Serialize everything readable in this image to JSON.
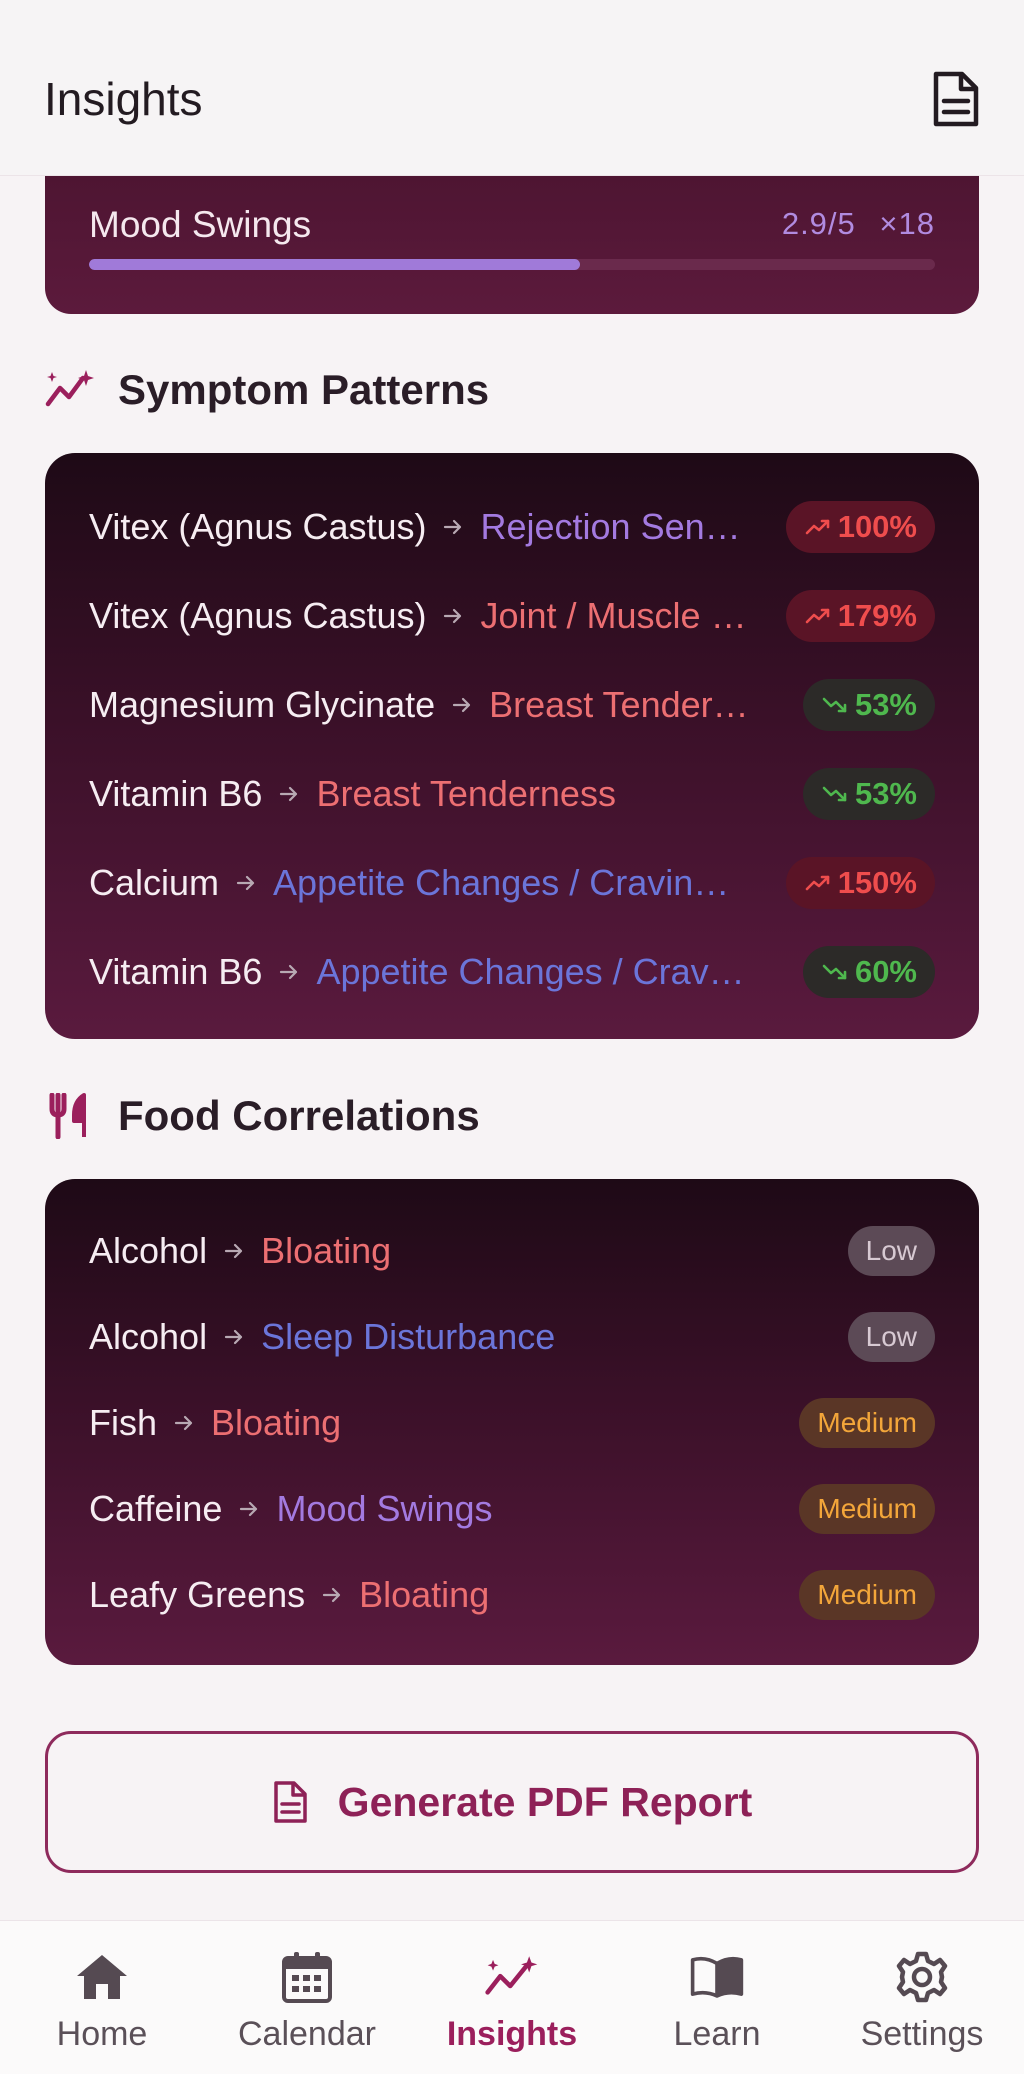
{
  "header": {
    "title": "Insights",
    "report_icon": "document-icon"
  },
  "mood_summary": {
    "name": "Mood Swings",
    "score": "2.9/5",
    "count": "×18",
    "fraction": 0.58,
    "fill_color": "#a07ad9"
  },
  "symptom_patterns": {
    "title": "Symptom Patterns",
    "icon": "trend-sparkle-icon",
    "rows": [
      {
        "supplement": "Vitex (Agnus Castus)",
        "symptom": "Rejection Sen…",
        "symptom_color": "#a37ae0",
        "change": "100%",
        "direction": "up"
      },
      {
        "supplement": "Vitex (Agnus Castus)",
        "symptom": "Joint / Muscle …",
        "symptom_color": "#ec6f72",
        "change": "179%",
        "direction": "up"
      },
      {
        "supplement": "Magnesium Glycinate",
        "symptom": "Breast Tender…",
        "symptom_color": "#ec6f72",
        "change": "53%",
        "direction": "down"
      },
      {
        "supplement": "Vitamin B6",
        "symptom": "Breast Tenderness",
        "symptom_color": "#ec6f72",
        "change": "53%",
        "direction": "down"
      },
      {
        "supplement": "Calcium",
        "symptom": "Appetite Changes / Cravin…",
        "symptom_color": "#6b75d9",
        "change": "150%",
        "direction": "up"
      },
      {
        "supplement": "Vitamin B6",
        "symptom": "Appetite Changes / Crav…",
        "symptom_color": "#6b75d9",
        "change": "60%",
        "direction": "down"
      }
    ]
  },
  "food_correlations": {
    "title": "Food Correlations",
    "icon": "fork-knife-icon",
    "rows": [
      {
        "food": "Alcohol",
        "symptom": "Bloating",
        "symptom_color": "#ec6f72",
        "strength": "Low"
      },
      {
        "food": "Alcohol",
        "symptom": "Sleep Disturbance",
        "symptom_color": "#6b75d9",
        "strength": "Low"
      },
      {
        "food": "Fish",
        "symptom": "Bloating",
        "symptom_color": "#ec6f72",
        "strength": "Medium"
      },
      {
        "food": "Caffeine",
        "symptom": "Mood Swings",
        "symptom_color": "#a37ae0",
        "strength": "Medium"
      },
      {
        "food": "Leafy Greens",
        "symptom": "Bloating",
        "symptom_color": "#ec6f72",
        "strength": "Medium"
      }
    ]
  },
  "pdf_button": {
    "label": "Generate PDF Report",
    "icon": "document-icon"
  },
  "tabs": [
    {
      "label": "Home",
      "icon": "home-icon",
      "active": false
    },
    {
      "label": "Calendar",
      "icon": "calendar-icon",
      "active": false
    },
    {
      "label": "Insights",
      "icon": "insights-icon",
      "active": true
    },
    {
      "label": "Learn",
      "icon": "book-icon",
      "active": false
    },
    {
      "label": "Settings",
      "icon": "gear-icon",
      "active": false
    }
  ],
  "colors": {
    "accent": "#9b1f5c",
    "up": "#ef4d4d",
    "down": "#4fb84e",
    "medium": "#f3a63a"
  }
}
